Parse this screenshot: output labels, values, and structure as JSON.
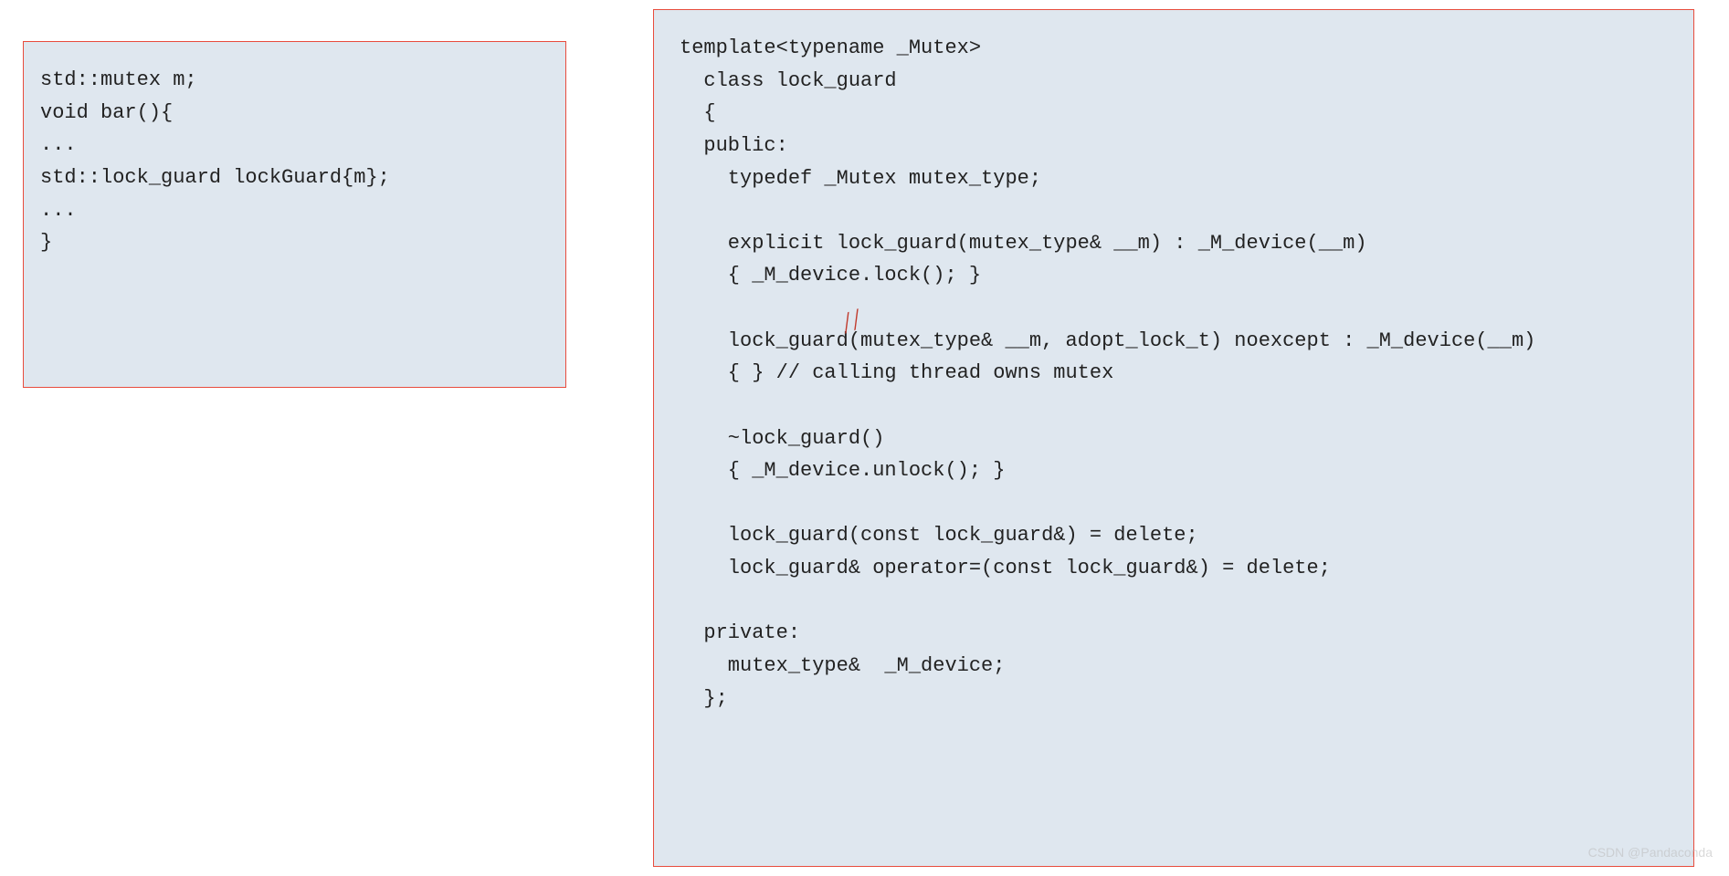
{
  "left_code": "std::mutex m;\nvoid bar(){\n...\nstd::lock_guard lockGuard{m};\n...\n}",
  "right_code": "template<typename _Mutex>\n  class lock_guard\n  {\n  public:\n    typedef _Mutex mutex_type;\n\n    explicit lock_guard(mutex_type& __m) : _M_device(__m)\n    { _M_device.lock(); }\n\n    lock_guard(mutex_type& __m, adopt_lock_t) noexcept : _M_device(__m)\n    { } // calling thread owns mutex\n\n    ~lock_guard()\n    { _M_device.unlock(); }\n\n    lock_guard(const lock_guard&) = delete;\n    lock_guard& operator=(const lock_guard&) = delete;\n\n  private:\n    mutex_type&  _M_device;\n  };",
  "watermark": "CSDN @Pandaconda"
}
